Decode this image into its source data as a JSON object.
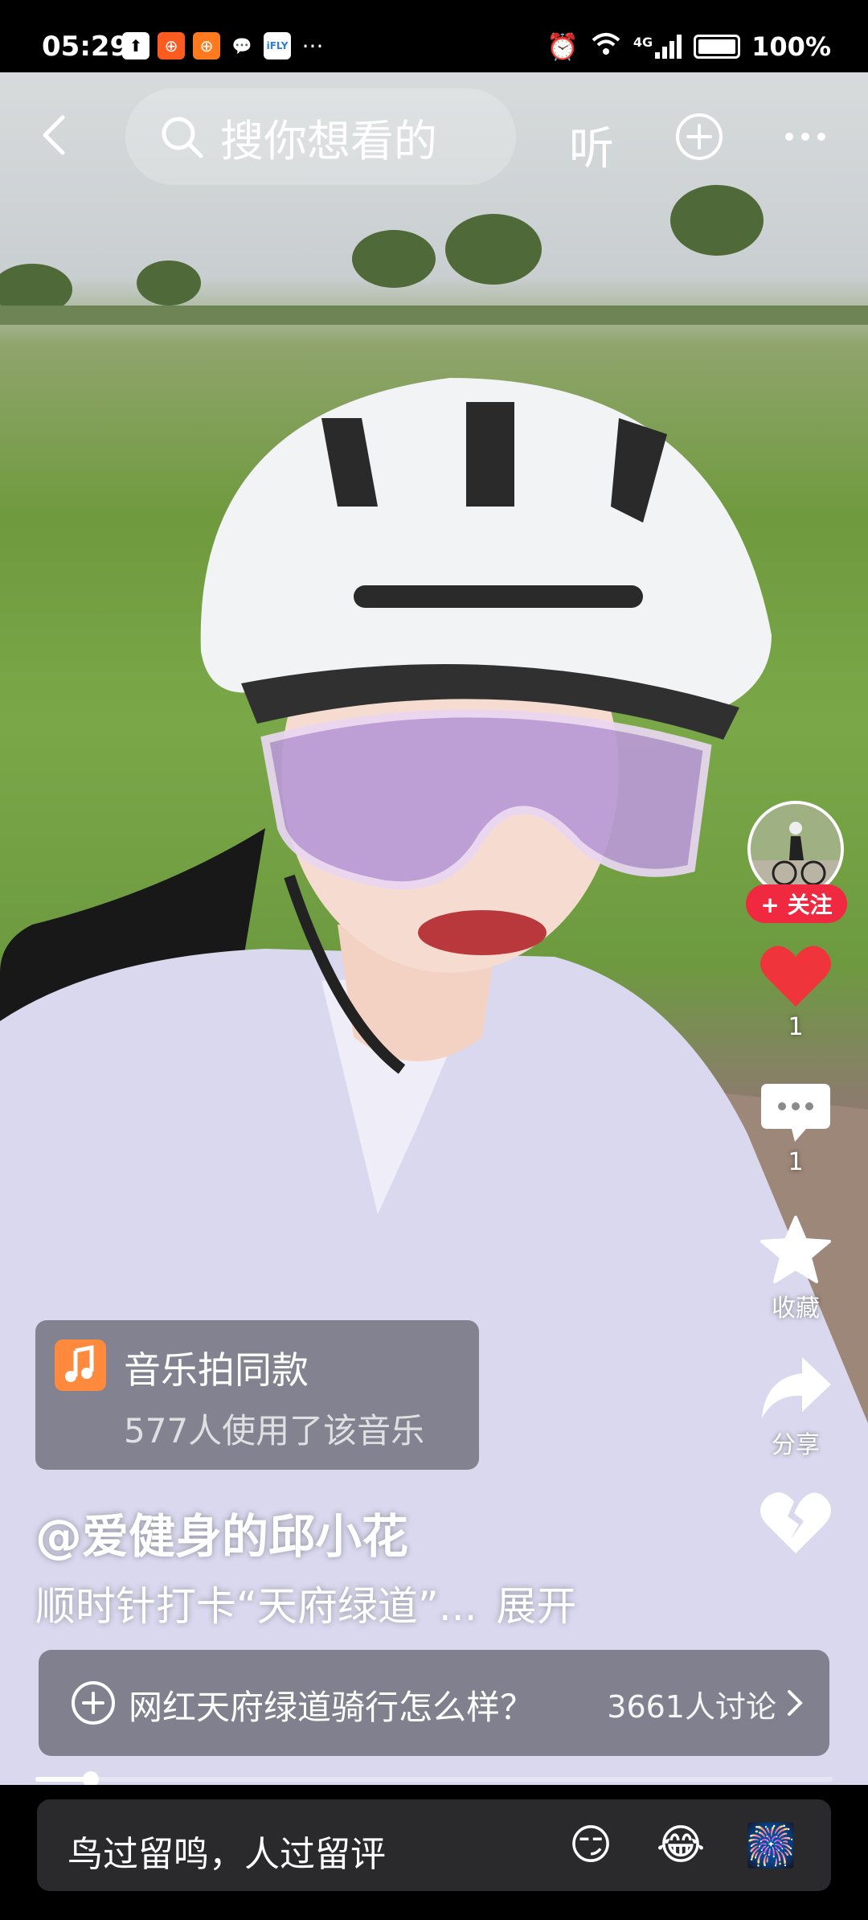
{
  "status_bar": {
    "time": "05:29",
    "notification_icons": [
      "upload-icon",
      "app-orange-icon",
      "app-orange-icon-2",
      "wechat-icon",
      "ifly-icon",
      "more-dots-icon"
    ],
    "network": "4G",
    "battery": "100%"
  },
  "top_nav": {
    "search_placeholder": "搜你想看的",
    "listen_label": "听"
  },
  "side_actions": {
    "follow_label": "+ 关注",
    "like_count": "1",
    "comment_count": "1",
    "favorite_label": "收藏",
    "share_label": "分享"
  },
  "music": {
    "title": "音乐拍同款",
    "usage": "577人使用了该音乐"
  },
  "post": {
    "author": "@爱健身的邱小花",
    "caption": "顺时针打卡“天府绿道”...",
    "expand_label": "展开"
  },
  "topic": {
    "text": "网红天府绿道骑行怎么样？",
    "discussion_count": "3661人讨论"
  },
  "progress": {
    "fraction": 0.07
  },
  "comment_bar": {
    "placeholder": "鸟过留鸣，人过留评",
    "emojis": [
      "smirk-emoji",
      "laughing-crying-emoji",
      "firework-emoji"
    ]
  },
  "colors": {
    "accent_red": "#f02840",
    "like_red": "#f0343c",
    "music_orange": "#ff8a3d"
  }
}
